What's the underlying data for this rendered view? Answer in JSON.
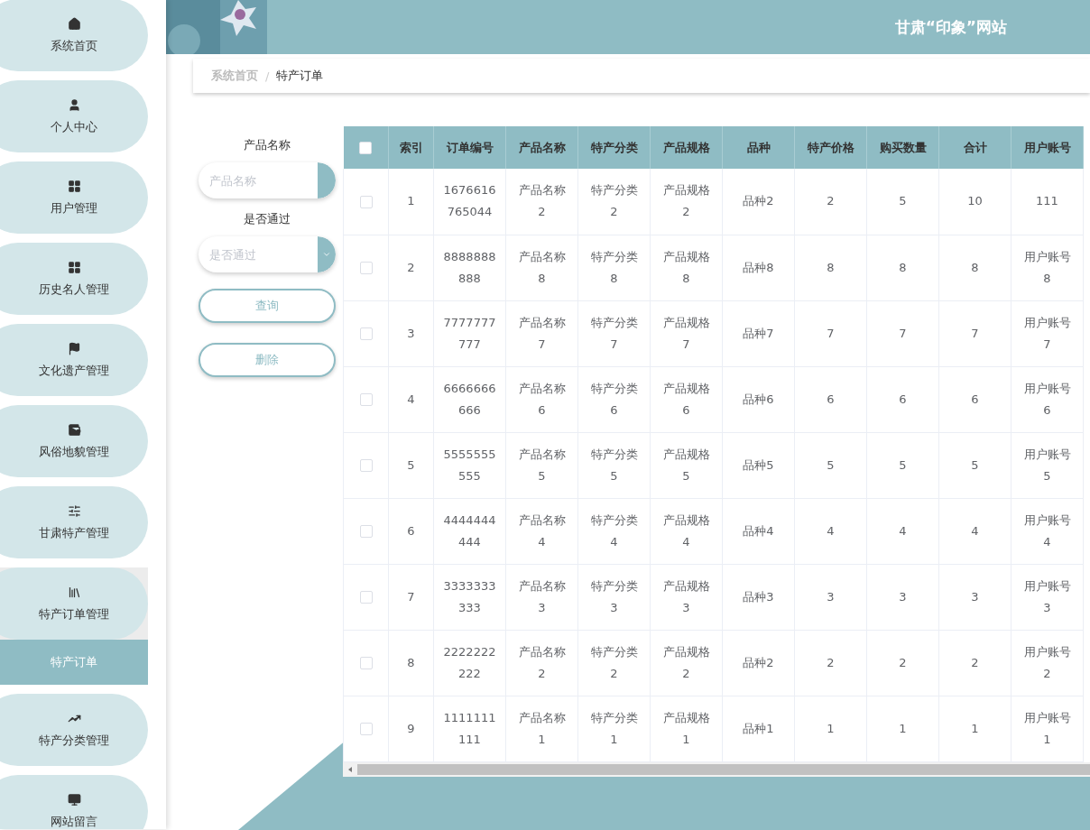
{
  "header": {
    "title": "甘肃“印象”网站"
  },
  "sidebar": {
    "items": [
      {
        "label": "系统首页",
        "selected": false
      },
      {
        "label": "个人中心",
        "selected": false
      },
      {
        "label": "用户管理",
        "selected": false
      },
      {
        "label": "历史名人管理",
        "selected": false
      },
      {
        "label": "文化遗产管理",
        "selected": false
      },
      {
        "label": "风俗地貌管理",
        "selected": false
      },
      {
        "label": "甘肃特产管理",
        "selected": false
      },
      {
        "label": "特产订单管理",
        "selected": false,
        "expanded": true,
        "children": [
          {
            "label": "特产订单",
            "selected": true
          }
        ]
      },
      {
        "label": "特产分类管理",
        "selected": false
      },
      {
        "label": "网站留言",
        "selected": false
      }
    ]
  },
  "breadcrumb": {
    "separator": "/",
    "items": [
      "系统首页",
      "特产订单"
    ]
  },
  "filters": {
    "fields": [
      {
        "kind": "input",
        "label": "产品名称",
        "placeholder": "产品名称"
      },
      {
        "kind": "select",
        "label": "是否通过",
        "placeholder": "是否通过"
      }
    ],
    "buttons": [
      "查询",
      "删除"
    ]
  },
  "table": {
    "select_all_checked": false,
    "columns": [
      "索引",
      "订单编号",
      "产品名称",
      "特产分类",
      "产品规格",
      "品种",
      "特产价格",
      "购买数量",
      "合计",
      "用户账号"
    ],
    "rows": [
      {
        "checked": false,
        "cells": [
          "1",
          "1676616765044",
          "产品名称2",
          "特产分类2",
          "产品规格2",
          "品种2",
          "2",
          "5",
          "10",
          "111"
        ]
      },
      {
        "checked": false,
        "cells": [
          "2",
          "8888888888",
          "产品名称8",
          "特产分类8",
          "产品规格8",
          "品种8",
          "8",
          "8",
          "8",
          "用户账号8"
        ]
      },
      {
        "checked": false,
        "cells": [
          "3",
          "7777777777",
          "产品名称7",
          "特产分类7",
          "产品规格7",
          "品种7",
          "7",
          "7",
          "7",
          "用户账号7"
        ]
      },
      {
        "checked": false,
        "cells": [
          "4",
          "6666666666",
          "产品名称6",
          "特产分类6",
          "产品规格6",
          "品种6",
          "6",
          "6",
          "6",
          "用户账号6"
        ]
      },
      {
        "checked": false,
        "cells": [
          "5",
          "5555555555",
          "产品名称5",
          "特产分类5",
          "产品规格5",
          "品种5",
          "5",
          "5",
          "5",
          "用户账号5"
        ]
      },
      {
        "checked": false,
        "cells": [
          "6",
          "4444444444",
          "产品名称4",
          "特产分类4",
          "产品规格4",
          "品种4",
          "4",
          "4",
          "4",
          "用户账号4"
        ]
      },
      {
        "checked": false,
        "cells": [
          "7",
          "3333333333",
          "产品名称3",
          "特产分类3",
          "产品规格3",
          "品种3",
          "3",
          "3",
          "3",
          "用户账号3"
        ]
      },
      {
        "checked": false,
        "cells": [
          "8",
          "2222222222",
          "产品名称2",
          "特产分类2",
          "产品规格2",
          "品种2",
          "2",
          "2",
          "2",
          "用户账号2"
        ]
      },
      {
        "checked": false,
        "cells": [
          "9",
          "1111111111",
          "产品名称1",
          "特产分类1",
          "产品规格1",
          "品种1",
          "1",
          "1",
          "1",
          "用户账号1"
        ]
      }
    ]
  }
}
